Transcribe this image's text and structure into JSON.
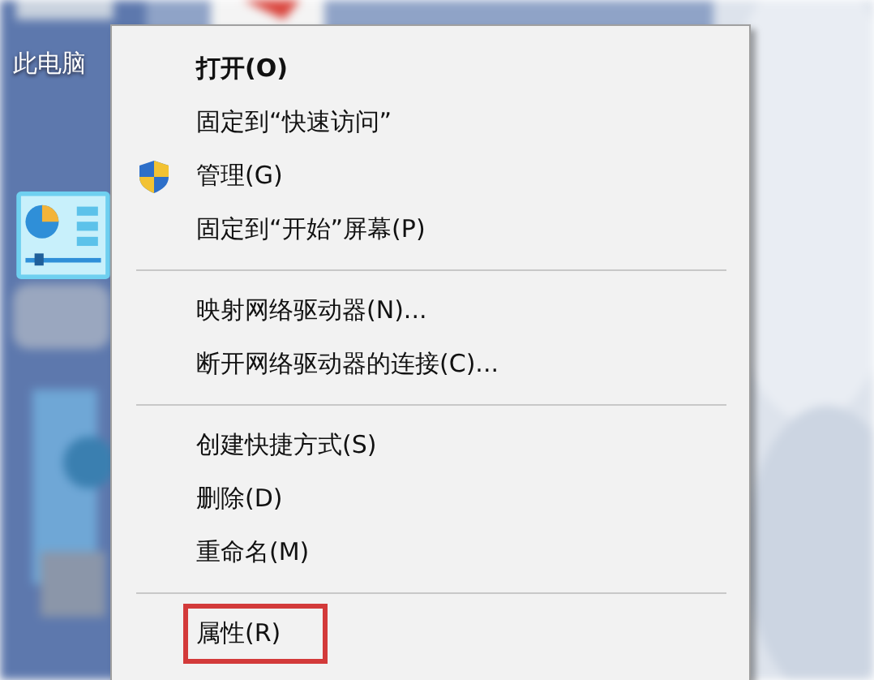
{
  "desktop": {
    "icon_label": "此电脑"
  },
  "menu": {
    "items": [
      {
        "kind": "item",
        "label": "打开(O)",
        "default": true,
        "shield": false,
        "highlighted": false
      },
      {
        "kind": "item",
        "label": "固定到“快速访问”",
        "default": false,
        "shield": false,
        "highlighted": false
      },
      {
        "kind": "item",
        "label": "管理(G)",
        "default": false,
        "shield": true,
        "highlighted": false
      },
      {
        "kind": "item",
        "label": "固定到“开始”屏幕(P)",
        "default": false,
        "shield": false,
        "highlighted": false
      },
      {
        "kind": "separator"
      },
      {
        "kind": "item",
        "label": "映射网络驱动器(N)...",
        "default": false,
        "shield": false,
        "highlighted": false
      },
      {
        "kind": "item",
        "label": "断开网络驱动器的连接(C)...",
        "default": false,
        "shield": false,
        "highlighted": false
      },
      {
        "kind": "separator"
      },
      {
        "kind": "item",
        "label": "创建快捷方式(S)",
        "default": false,
        "shield": false,
        "highlighted": false
      },
      {
        "kind": "item",
        "label": "删除(D)",
        "default": false,
        "shield": false,
        "highlighted": false
      },
      {
        "kind": "item",
        "label": "重命名(M)",
        "default": false,
        "shield": false,
        "highlighted": false
      },
      {
        "kind": "separator"
      },
      {
        "kind": "item",
        "label": "属性(R)",
        "default": false,
        "shield": false,
        "highlighted": true
      }
    ]
  }
}
